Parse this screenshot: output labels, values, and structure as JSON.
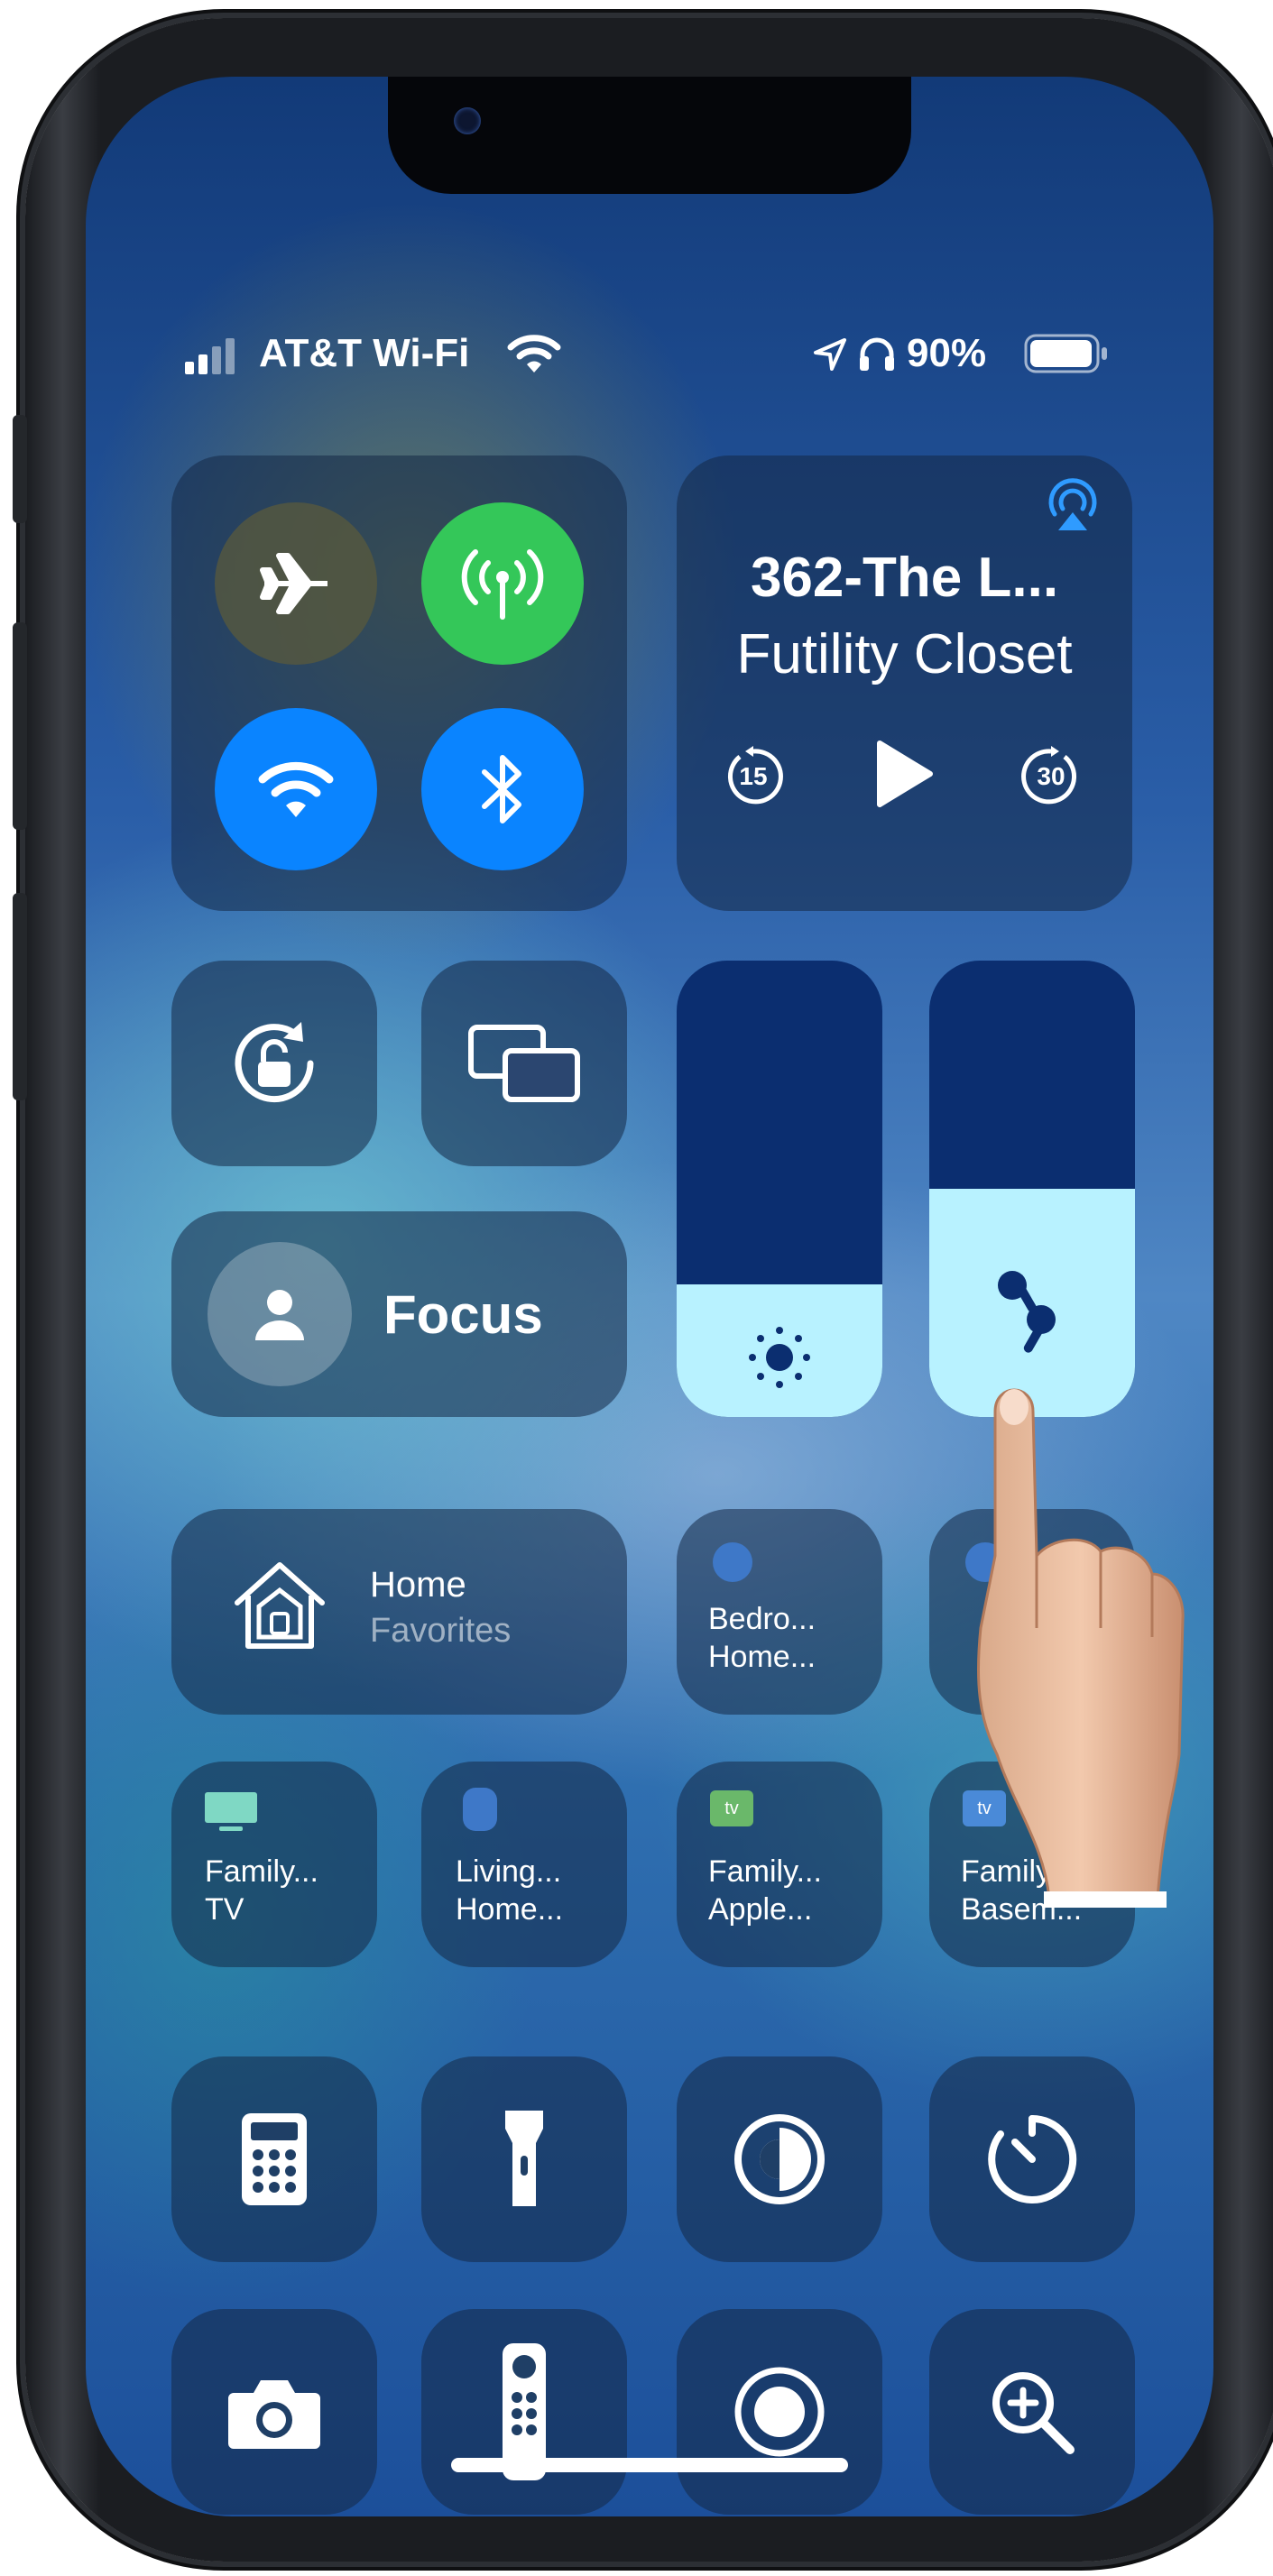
{
  "status_bar": {
    "carrier": "AT&T Wi-Fi",
    "battery": "90%"
  },
  "connectivity": {
    "airplane": "airplane-icon",
    "cellular": "cellular-data-icon",
    "wifi": "wifi-icon",
    "bluetooth": "bluetooth-icon",
    "cellular_color": "#34c759",
    "active_color": "#0a84ff"
  },
  "now_playing": {
    "title": "362-The L...",
    "artist": "Futility Closet",
    "skip_back": "15",
    "skip_forward": "30"
  },
  "focus": {
    "label": "Focus"
  },
  "sliders": {
    "brightness_level": 0.29,
    "volume_level": 0.5
  },
  "home": {
    "title": "Home",
    "subtitle": "Favorites"
  },
  "accessories": [
    {
      "line1": "Bedro...",
      "line2": "Home..."
    },
    {
      "line1": "Family...",
      "line2": "TV"
    },
    {
      "line1": "Living...",
      "line2": "Home..."
    },
    {
      "line1": "Family...",
      "line2": "Apple..."
    },
    {
      "line1": "Family...",
      "line2": "Basem..."
    }
  ],
  "appletv_badge": "tv"
}
